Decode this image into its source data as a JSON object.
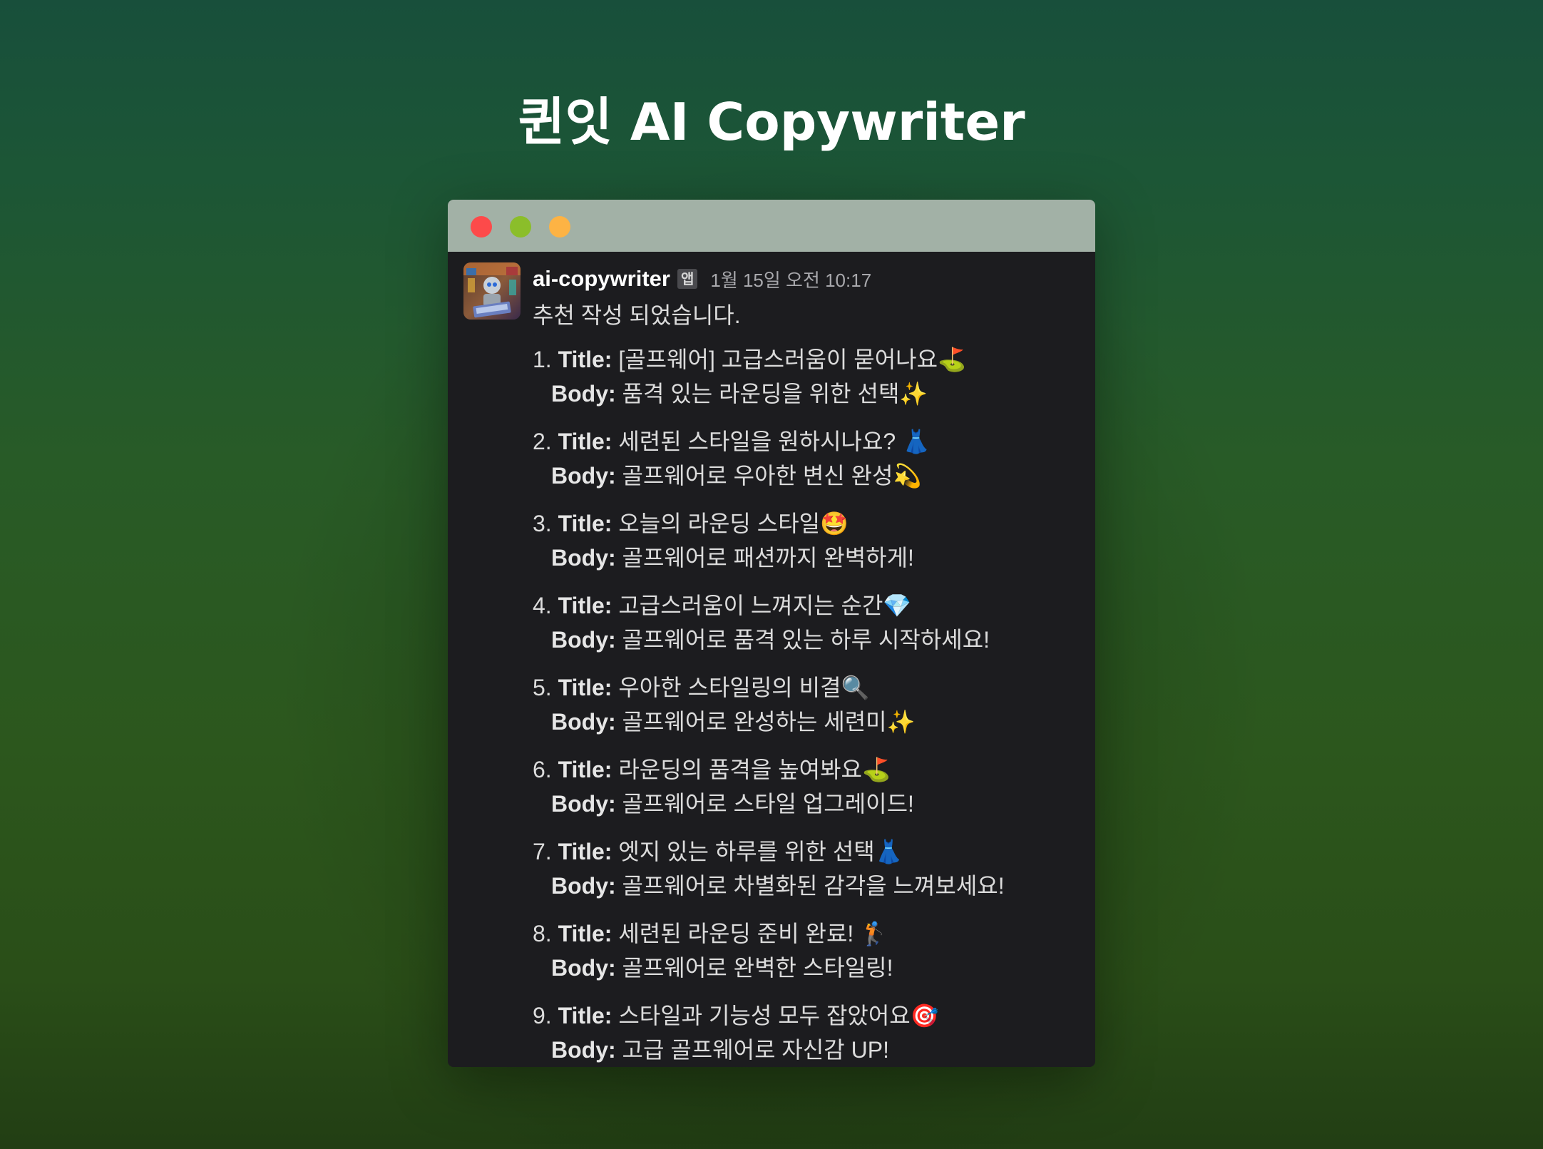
{
  "page": {
    "title": "퀸잇 AI Copywriter"
  },
  "window": {
    "controls": [
      "close",
      "minimize",
      "maximize"
    ],
    "colors": {
      "close": "#fd4a4a",
      "minimize": "#8bbe2a",
      "maximize": "#fdb344",
      "titlebar": "#a2b1a6",
      "body": "#1c1c1f"
    }
  },
  "message": {
    "sender": "ai-copywriter",
    "badge": "앱",
    "timestamp": "1월 15일 오전 10:17",
    "intro": "추천 작성 되었습니다.",
    "title_label": "Title:",
    "body_label": "Body:",
    "items": [
      {
        "num": "1.",
        "title": "[골프웨어] 고급스러움이 묻어나요⛳",
        "body": "품격 있는 라운딩을 위한 선택✨"
      },
      {
        "num": "2.",
        "title": "세련된 스타일을 원하시나요? 👗",
        "body": "골프웨어로 우아한 변신 완성💫"
      },
      {
        "num": "3.",
        "title": "오늘의 라운딩 스타일🤩",
        "body": "골프웨어로 패션까지 완벽하게!"
      },
      {
        "num": "4.",
        "title": "고급스러움이 느껴지는 순간💎",
        "body": "골프웨어로 품격 있는 하루 시작하세요!"
      },
      {
        "num": "5.",
        "title": "우아한 스타일링의 비결🔍",
        "body": "골프웨어로 완성하는 세련미✨"
      },
      {
        "num": "6.",
        "title": "라운딩의 품격을 높여봐요⛳",
        "body": "골프웨어로 스타일 업그레이드!"
      },
      {
        "num": "7.",
        "title": "엣지 있는 하루를 위한 선택👗",
        "body": "골프웨어로 차별화된 감각을 느껴보세요!"
      },
      {
        "num": "8.",
        "title": "세련된 라운딩 준비 완료! 🏌",
        "body": "골프웨어로 완벽한 스타일링!"
      },
      {
        "num": "9.",
        "title": "스타일과 기능성 모두 잡았어요🎯",
        "body": "고급 골프웨어로 자신감 UP!"
      }
    ]
  }
}
